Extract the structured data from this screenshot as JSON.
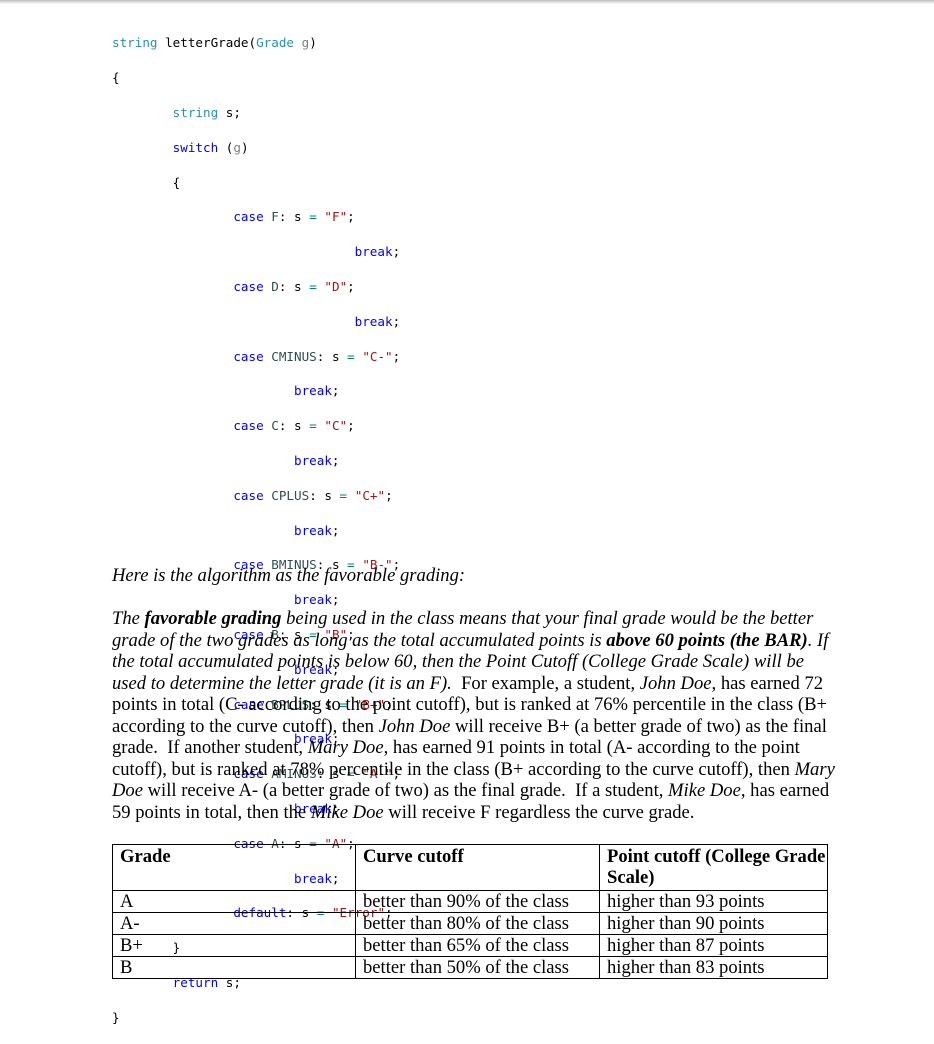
{
  "code": {
    "func_return_type": "string",
    "func_name": "letterGrade",
    "param_type": "Grade",
    "param_name": "g",
    "open_brace": "{",
    "close_brace": "}",
    "decl_type": "string",
    "decl_var": "s;",
    "switch_kw": "switch",
    "switch_arg": "g",
    "return_kw": "return",
    "return_val": "s;",
    "cases": [
      {
        "label": "F",
        "value": "\"F\""
      },
      {
        "label": "D",
        "value": "\"D\""
      },
      {
        "label": "CMINUS",
        "value": "\"C-\""
      },
      {
        "label": "C",
        "value": "\"C\""
      },
      {
        "label": "CPLUS",
        "value": "\"C+\""
      },
      {
        "label": "BMINUS",
        "value": "\"B-\""
      },
      {
        "label": "B",
        "value": "\"B\""
      },
      {
        "label": "BPLUS",
        "value": "\"B+\""
      },
      {
        "label": "AMINUS",
        "value": "\"A-\""
      },
      {
        "label": "A",
        "value": "\"A\""
      }
    ],
    "case_kw": "case",
    "break_kw": "break",
    "default_kw": "default",
    "default_value": "\"Error\"",
    "var": "s",
    "assign": "="
  },
  "heading": "Here is the algorithm as the favorable grading:",
  "paragraph": {
    "l1a": "The ",
    "l1b": "favorable grading",
    "l1c": " being used in the class means that your final grade would be the better",
    "l2a": "grade of the two grades as long as the total accumulated points is ",
    "l2b": "above 60 points (the BAR)",
    "l2c": ". If",
    "l3": "the total accumulated points is below 60, then the Point Cutoff (College Grade Scale) will be",
    "l4a": "used to determine the letter grade (it is an F).",
    "l4b": "  For example, a student, ",
    "l4c": "John Doe,",
    "l4d": " has earned 72",
    "l5": "points in total (C- according to the point cutoff), but is ranked at 76% percentile in the class (B+",
    "l6a": "according to the curve cutoff), then ",
    "l6b": "John Doe",
    "l6c": " will receive B+ (a better grade of two) as the final",
    "l7a": "grade.  If another student, ",
    "l7b": "Mary Doe",
    "l7c": ", has earned 91 points in total (A- according to the point",
    "l8a": "cutoff), but is ranked at 78% percentile in the class (B+ according to the curve cutoff), then ",
    "l8b": "Mary",
    "l9a": "Doe",
    "l9b": " will receive A- (a better grade of two) as the final grade.  If a student, ",
    "l9c": "Mike Doe",
    "l9d": ", has earned",
    "l10a": "59 points in total, then the ",
    "l10b": "Mike Doe",
    "l10c": " will receive F regardless the curve grade."
  },
  "table": {
    "headers": [
      "Grade",
      "Curve cutoff",
      "Point cutoff (College Grade Scale)"
    ],
    "rows": [
      [
        "A",
        "better than 90% of the class",
        "higher than 93 points"
      ],
      [
        "A-",
        "better than 80% of the class",
        "higher than 90 points"
      ],
      [
        "B+",
        "better than 65% of the class",
        "higher than 87 points"
      ],
      [
        "B",
        "better than 50% of the class",
        "higher than 83 points"
      ]
    ]
  }
}
